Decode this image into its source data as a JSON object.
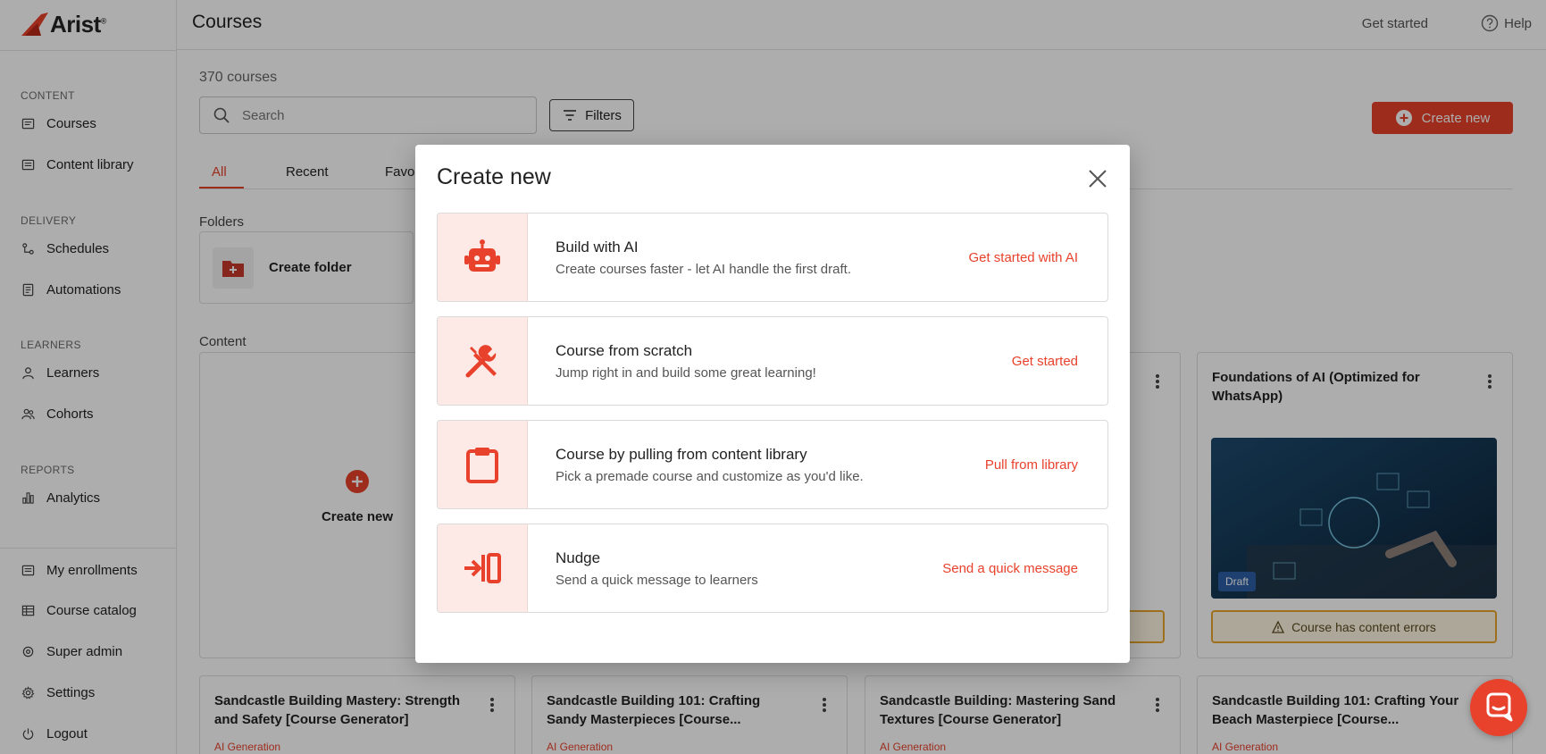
{
  "brand": {
    "name": "Arist",
    "mark": "®",
    "accent": "#e8412c"
  },
  "sidebar": {
    "sections": [
      {
        "label": "CONTENT",
        "items": [
          {
            "label": "Courses",
            "icon": "courses-icon"
          },
          {
            "label": "Content library",
            "icon": "library-icon"
          }
        ]
      },
      {
        "label": "DELIVERY",
        "items": [
          {
            "label": "Schedules",
            "icon": "schedule-icon"
          },
          {
            "label": "Automations",
            "icon": "automation-icon"
          }
        ]
      },
      {
        "label": "LEARNERS",
        "items": [
          {
            "label": "Learners",
            "icon": "user-icon"
          },
          {
            "label": "Cohorts",
            "icon": "users-icon"
          }
        ]
      },
      {
        "label": "REPORTS",
        "items": [
          {
            "label": "Analytics",
            "icon": "analytics-icon"
          }
        ]
      }
    ],
    "bottom": [
      {
        "label": "My enrollments",
        "icon": "enrollments-icon"
      },
      {
        "label": "Course catalog",
        "icon": "catalog-icon"
      },
      {
        "label": "Super admin",
        "icon": "admin-icon"
      },
      {
        "label": "Settings",
        "icon": "gear-icon"
      },
      {
        "label": "Logout",
        "icon": "power-icon"
      }
    ]
  },
  "header": {
    "title": "Courses",
    "get_started": "Get started",
    "help": "Help"
  },
  "toolbar": {
    "count": "370 courses",
    "search_placeholder": "Search",
    "filters": "Filters",
    "create_new": "Create new"
  },
  "tabs": [
    "All",
    "Recent",
    "Favor"
  ],
  "folders": {
    "label": "Folders",
    "create_folder": "Create folder"
  },
  "content": {
    "label": "Content",
    "create_new": "Create new",
    "featured": {
      "title": "Foundations of AI (Optimized for WhatsApp)",
      "badge": "Draft",
      "error": "Course has content errors"
    },
    "bottom_cards": [
      {
        "title": "Sandcastle Building Mastery: Strength and Safety [Course Generator]",
        "tag": "AI Generation"
      },
      {
        "title": "Sandcastle Building 101: Crafting Sandy Masterpieces [Course...",
        "tag": "AI Generation"
      },
      {
        "title": "Sandcastle Building: Mastering Sand Textures [Course Generator]",
        "tag": "AI Generation"
      },
      {
        "title": "Sandcastle Building 101: Crafting Your Beach Masterpiece [Course...",
        "tag": "AI Generation"
      }
    ]
  },
  "modal": {
    "title": "Create new",
    "options": [
      {
        "title": "Build with AI",
        "desc": "Create courses faster - let AI handle the first draft.",
        "action": "Get started with AI",
        "icon": "robot-icon"
      },
      {
        "title": "Course from scratch",
        "desc": "Jump right in and build some great learning!",
        "action": "Get started",
        "icon": "tools-icon"
      },
      {
        "title": "Course by pulling from content library",
        "desc": "Pick a premade course and customize as you'd like.",
        "action": "Pull from library",
        "icon": "clipboard-icon"
      },
      {
        "title": "Nudge",
        "desc": "Send a quick message to learners",
        "action": "Send a quick message",
        "icon": "nudge-icon"
      }
    ]
  }
}
